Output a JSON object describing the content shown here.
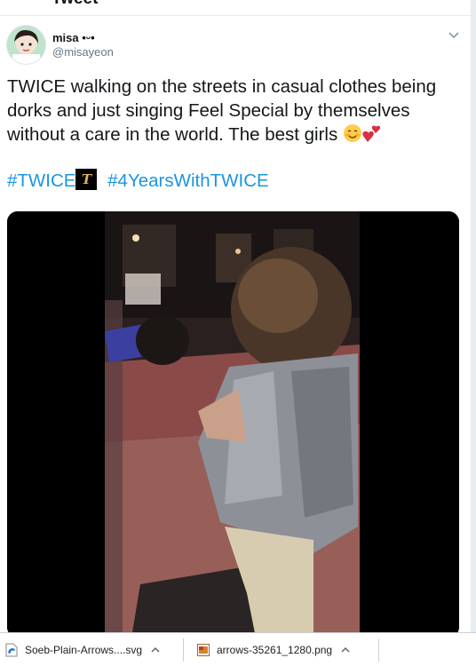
{
  "header": {
    "cut_title": "Tweet"
  },
  "tweet": {
    "display_name": "misa •ᵕ•",
    "handle": "@misayeon",
    "text": "TWICE walking on the streets in casual clothes being dorks and just singing Feel Special by themselves without a care in the world. The best girls",
    "emojis": [
      "smiling-face-emoji",
      "two-hearts-emoji"
    ],
    "hashtags": [
      "#TWICE",
      "#4YearsWithTWICE"
    ],
    "hashflag_letter": "T",
    "media_type": "video"
  },
  "downloads": {
    "items": [
      {
        "name": "Soeb-Plain-Arrows....svg",
        "icon": "edge-svg-file-icon"
      },
      {
        "name": "arrows-35261_1280.png",
        "icon": "image-file-icon"
      }
    ]
  },
  "colors": {
    "text": "#14171a",
    "secondary": "#657786",
    "link": "#1b95e0",
    "background": "#e6ecf0"
  }
}
